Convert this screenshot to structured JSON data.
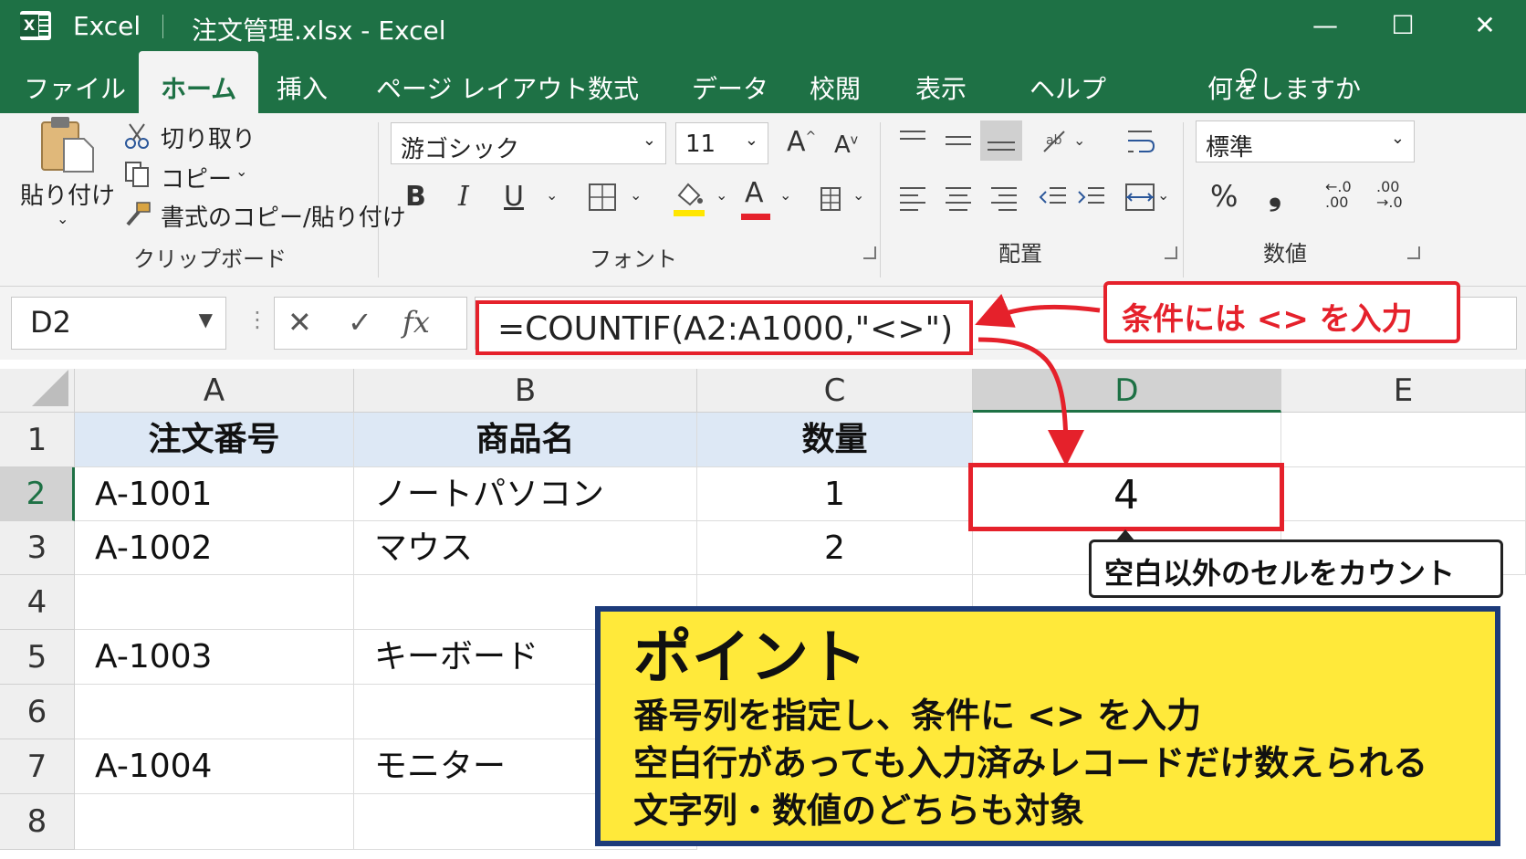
{
  "window": {
    "app_name": "Excel",
    "title": "注文管理.xlsx  -  Excel",
    "controls": {
      "minimize": "—",
      "maximize": "☐",
      "close": "✕"
    }
  },
  "ribbon_tabs": [
    "ファイル",
    "ホーム",
    "挿入",
    "ページ レイアウト",
    "数式",
    "データ",
    "校閲",
    "表示",
    "ヘルプ"
  ],
  "active_tab": "ホーム",
  "tell_me": "何をしますか",
  "clipboard": {
    "paste": "貼り付け",
    "cut": "切り取り",
    "copy": "コピー",
    "format_painter": "書式のコピー/貼り付け",
    "label": "クリップボード"
  },
  "font": {
    "name": "游ゴシック",
    "size": "11",
    "grow": "A",
    "shrink": "A",
    "bold": "B",
    "italic": "I",
    "underline": "U",
    "font_color_letter": "A",
    "label": "フォント",
    "fill_color": "#ffe600",
    "text_color": "#e5212b"
  },
  "alignment": {
    "label": "配置"
  },
  "number": {
    "format": "標準",
    "percent": "%",
    "comma": "❟",
    "inc_decimal_top": "←.0",
    "inc_decimal_bottom": ".00",
    "dec_decimal_top": ".00",
    "dec_decimal_bottom": "→.0",
    "label": "数値"
  },
  "formula_bar": {
    "name_box": "D2",
    "dots": "⋮",
    "cancel": "✕",
    "enter": "✓",
    "fx": "fx",
    "formula": "=COUNTIF(A2:A1000,\"<>\")"
  },
  "callout_condition": "条件には <> を入力",
  "columns": [
    "A",
    "B",
    "C",
    "D",
    "E"
  ],
  "selected_column": "D",
  "rows": [
    "1",
    "2",
    "3",
    "4",
    "5",
    "6",
    "7",
    "8"
  ],
  "selected_row": "2",
  "table": {
    "headers": [
      "注文番号",
      "商品名",
      "数量"
    ],
    "data": [
      [
        "A-1001",
        "ノートパソコン",
        "1"
      ],
      [
        "A-1002",
        "マウス",
        "2"
      ],
      [
        "",
        "",
        ""
      ],
      [
        "A-1003",
        "キーボード",
        ""
      ],
      [
        "",
        "",
        ""
      ],
      [
        "A-1004",
        "モニター",
        ""
      ]
    ]
  },
  "result_cell": "4",
  "callout_result": "空白以外のセルをカウント",
  "point": {
    "title": "ポイント",
    "lines": [
      "番号列を指定し、条件に <> を入力",
      "空白行があっても入力済みレコードだけ数えられる",
      "文字列・数値のどちらも対象"
    ]
  },
  "colors": {
    "excel_green": "#1e7145",
    "highlight_red": "#e5212b",
    "point_yellow": "#ffe93a",
    "point_border": "#1d3b7a",
    "header_fill": "#dde8f5"
  }
}
